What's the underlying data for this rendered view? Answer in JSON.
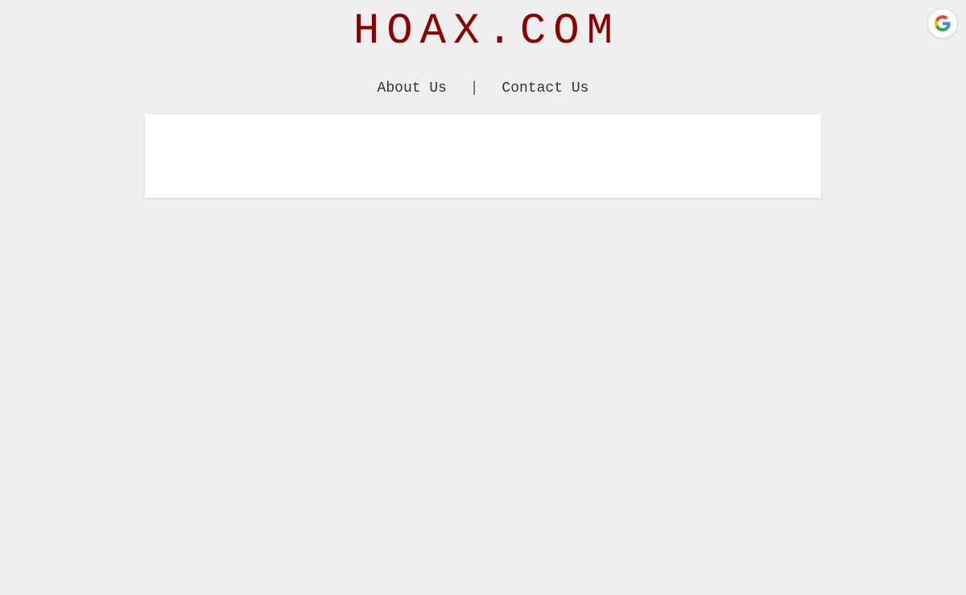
{
  "header": {
    "site_title": "HOAX.COM",
    "title_color": "#8b0000"
  },
  "nav": {
    "items": [
      {
        "label": "About Us"
      },
      {
        "label": "Contact Us"
      }
    ],
    "separator": "|"
  },
  "page": {
    "background_color": "#efefef",
    "card_color": "#ffffff"
  },
  "google_button": {
    "icon": "google-g-icon",
    "aria_label": "Sign in with Google"
  }
}
